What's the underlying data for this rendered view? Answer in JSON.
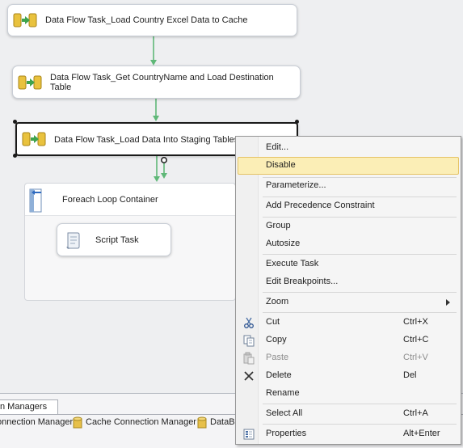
{
  "tasks": [
    {
      "label": "Data Flow Task_Load Country Excel Data to Cache"
    },
    {
      "label": "Data Flow Task_Get CountryName and Load Destination Table"
    },
    {
      "label": "Data Flow Task_Load Data Into Staging Tables"
    }
  ],
  "container": {
    "title": "Foreach Loop Container",
    "script_task": "Script Task"
  },
  "connections": {
    "tab_label": "n Managers",
    "items": [
      "onnection Manager",
      "Cache Connection Manager",
      "DataBa"
    ]
  },
  "context_menu": {
    "items": [
      {
        "label": "Edit...",
        "shortcut": ""
      },
      {
        "label": "Disable",
        "shortcut": ""
      },
      {
        "label": "Parameterize...",
        "shortcut": ""
      },
      {
        "label": "Add Precedence Constraint",
        "shortcut": ""
      },
      {
        "label": "Group",
        "shortcut": ""
      },
      {
        "label": "Autosize",
        "shortcut": ""
      },
      {
        "label": "Execute Task",
        "shortcut": ""
      },
      {
        "label": "Edit Breakpoints...",
        "shortcut": ""
      },
      {
        "label": "Zoom",
        "shortcut": ""
      },
      {
        "label": "Cut",
        "shortcut": "Ctrl+X"
      },
      {
        "label": "Copy",
        "shortcut": "Ctrl+C"
      },
      {
        "label": "Paste",
        "shortcut": "Ctrl+V"
      },
      {
        "label": "Delete",
        "shortcut": "Del"
      },
      {
        "label": "Rename",
        "shortcut": ""
      },
      {
        "label": "Select All",
        "shortcut": "Ctrl+A"
      },
      {
        "label": "Properties",
        "shortcut": "Alt+Enter"
      }
    ]
  },
  "colors": {
    "connector_green": "#5fb878",
    "menu_highlight": "#fbeeb6"
  }
}
